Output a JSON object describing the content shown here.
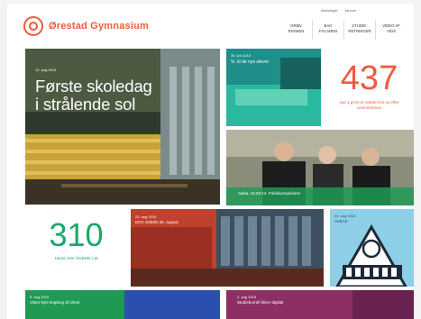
{
  "header": {
    "logo_text": "Ørestad Gymnasium",
    "util_links": [
      "Ulekologie",
      "Arhiver"
    ],
    "nav": [
      {
        "label": "ORØV\nRIGWEN"
      },
      {
        "label": "BAG\nFACADEN"
      },
      {
        "label": "STUDIE-\nRETNINGER"
      },
      {
        "label": "VIDEO AF\nVIDS"
      }
    ]
  },
  "hero": {
    "date": "12. aug 2015",
    "title": "Første skoledag\ni strålende sol"
  },
  "tile_pool": {
    "date": "30. jun 2015",
    "caption": "Vi. til de nye elever"
  },
  "stat_437": {
    "number": "437",
    "caption": "nye 1.g'ere er startet hos os efter sommerferien"
  },
  "tile_grads": {
    "caption": "Aalsa, 16.03.14. Publikumspriseen"
  },
  "stat_310": {
    "number": "310",
    "caption": "Havet Vein Ündetter Lat"
  },
  "tile_red": {
    "date": "23. aug 2015",
    "caption": "DKG Gebrtis 28. august"
  },
  "tile_avedore": {
    "date": "20. aug 2015",
    "caption": "AVEAE"
  },
  "tile_green": {
    "date": "5. aug 2015",
    "caption": "Video byle tingbing af ûlmat"
  },
  "tile_purple": {
    "date": "2. aug 2015",
    "caption": "Studieborrell bliver digitalt"
  },
  "colors": {
    "brand_orange": "#f05a3c",
    "brand_green": "#1aa86a",
    "accent_teal": "#1f8f8a",
    "accent_red": "#c0412e",
    "accent_purple": "#8d2f62"
  }
}
